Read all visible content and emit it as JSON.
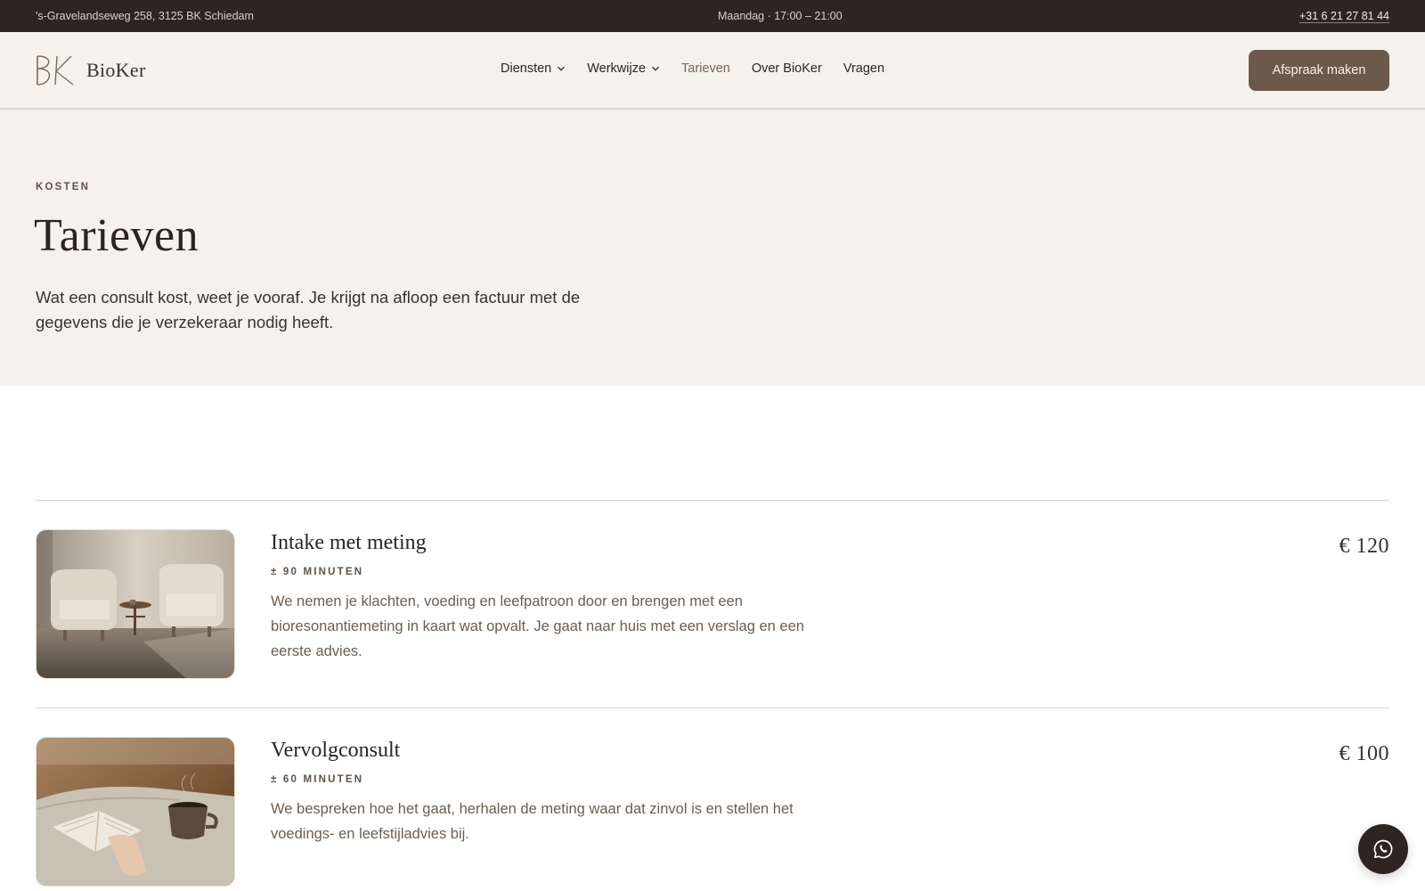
{
  "topbar": {
    "address": "'s-Gravelandseweg 258, 3125 BK Schiedam",
    "hours": "Maandag · 17:00 – 21:00",
    "phone": "+31 6 21 27 81 44"
  },
  "header": {
    "logo_text": "BioKer",
    "logo_icon": "bk-monogram-icon",
    "nav": [
      {
        "label": "Diensten",
        "has_dropdown": true
      },
      {
        "label": "Werkwijze",
        "has_dropdown": true
      },
      {
        "label": "Tarieven",
        "has_dropdown": false,
        "active": true
      },
      {
        "label": "Over BioKer",
        "has_dropdown": false
      },
      {
        "label": "Vragen",
        "has_dropdown": false
      }
    ],
    "cta_label": "Afspraak maken"
  },
  "hero": {
    "eyebrow": "KOSTEN",
    "title": "Tarieven",
    "intro": "Wat een consult kost, weet je vooraf. Je krijgt na afloop een factuur met de gegevens die je verzekeraar nodig heeft."
  },
  "services": [
    {
      "title": "Intake met meting",
      "duration": "± 90 MINUTEN",
      "description": "We nemen je klachten, voeding en leefpatroon door en brengen met een bioresonantiemeting in kaart wat opvalt. Je gaat naar huis met een verslag en een eerste advies.",
      "price": "€ 120",
      "image": "two-armchairs-photo"
    },
    {
      "title": "Vervolgconsult",
      "duration": "± 60 MINUTEN",
      "description": "We bespreken hoe het gaat, herhalen de meting waar dat zinvol is en stellen het voedings- en leefstijladvies bij.",
      "price": "€ 100",
      "image": "book-and-coffee-photo"
    }
  ],
  "floating": {
    "icon": "whatsapp-icon"
  },
  "colors": {
    "topbar_bg": "#2e2522",
    "header_bg": "#f5f1eb",
    "accent": "#6b5a4b",
    "active_nav": "#7a6655",
    "muted_text": "#6b5d52"
  }
}
